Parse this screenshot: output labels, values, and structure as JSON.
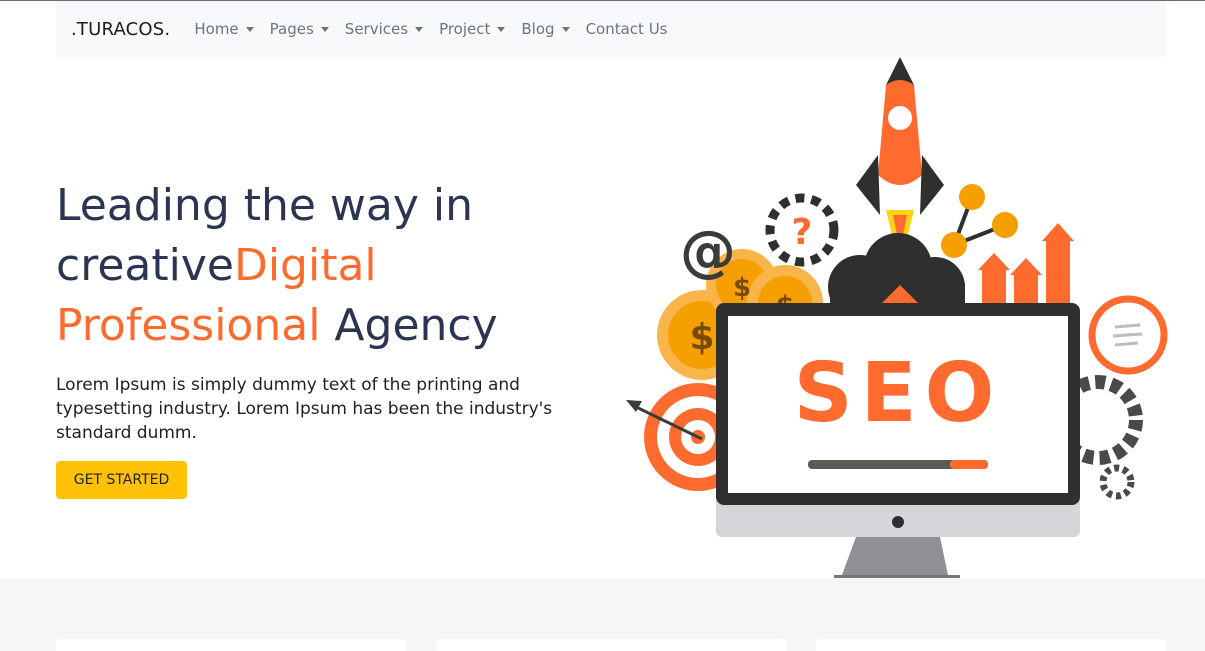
{
  "brand": ".TURACOS.",
  "nav": [
    {
      "label": "Home",
      "dropdown": true
    },
    {
      "label": "Pages",
      "dropdown": true
    },
    {
      "label": "Services",
      "dropdown": true
    },
    {
      "label": "Project",
      "dropdown": true
    },
    {
      "label": "Blog",
      "dropdown": true
    },
    {
      "label": "Contact Us",
      "dropdown": false
    }
  ],
  "hero": {
    "title_line1": "Leading the way in",
    "title_part2": "creative",
    "title_accent1": "Digital",
    "title_accent2": "Professional",
    "title_part3": " Agency",
    "description": "Lorem Ipsum is simply dummy text of the printing and typesetting industry. Lorem Ipsum has been the industry's standard dumm.",
    "cta_label": "GET STARTED"
  },
  "illustration": {
    "screen_text": "SEO",
    "at_symbol": "@",
    "question_mark": "?",
    "dollar": "$"
  },
  "colors": {
    "accent": "#ff6a2e",
    "cta": "#ffc107",
    "heading": "#2b3552",
    "nav_bg": "#f8f9fa"
  }
}
